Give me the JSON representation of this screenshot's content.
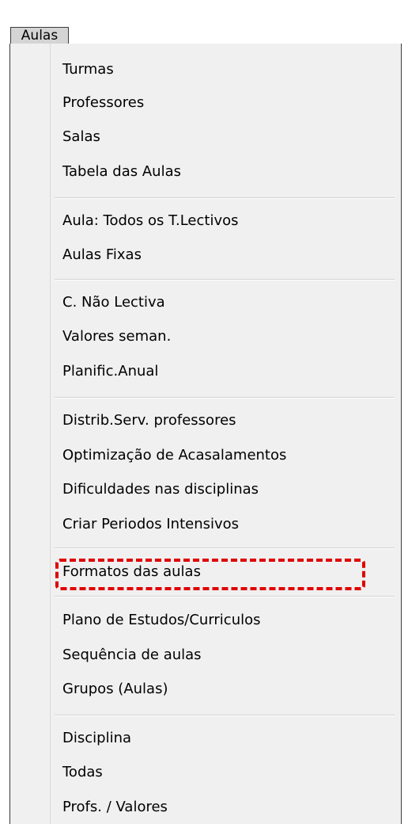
{
  "menubar": {
    "active_menu": "Aulas"
  },
  "menu": {
    "items": [
      {
        "label": "Turmas"
      },
      {
        "label": "Professores"
      },
      {
        "label": "Salas"
      },
      {
        "label": "Tabela das Aulas"
      },
      {
        "label": "Aula: Todos os T.Lectivos"
      },
      {
        "label": "Aulas Fixas"
      },
      {
        "label": "C. Não Lectiva"
      },
      {
        "label": "Valores seman."
      },
      {
        "label": "Planific.Anual"
      },
      {
        "label": "Distrib.Serv. professores"
      },
      {
        "label": "Optimização de Acasalamentos"
      },
      {
        "label": "Dificuldades nas disciplinas"
      },
      {
        "label": "Criar Periodos Intensivos"
      },
      {
        "label": "Formatos das aulas"
      },
      {
        "label": "Plano de Estudos/Curriculos"
      },
      {
        "label": "Sequência de aulas"
      },
      {
        "label": "Grupos (Aulas)"
      },
      {
        "label": "Disciplina"
      },
      {
        "label": "Todas"
      },
      {
        "label": "Profs. / Valores"
      }
    ]
  },
  "annotation": {
    "highlighted_item": "Formatos das aulas",
    "color": "#e00000"
  }
}
